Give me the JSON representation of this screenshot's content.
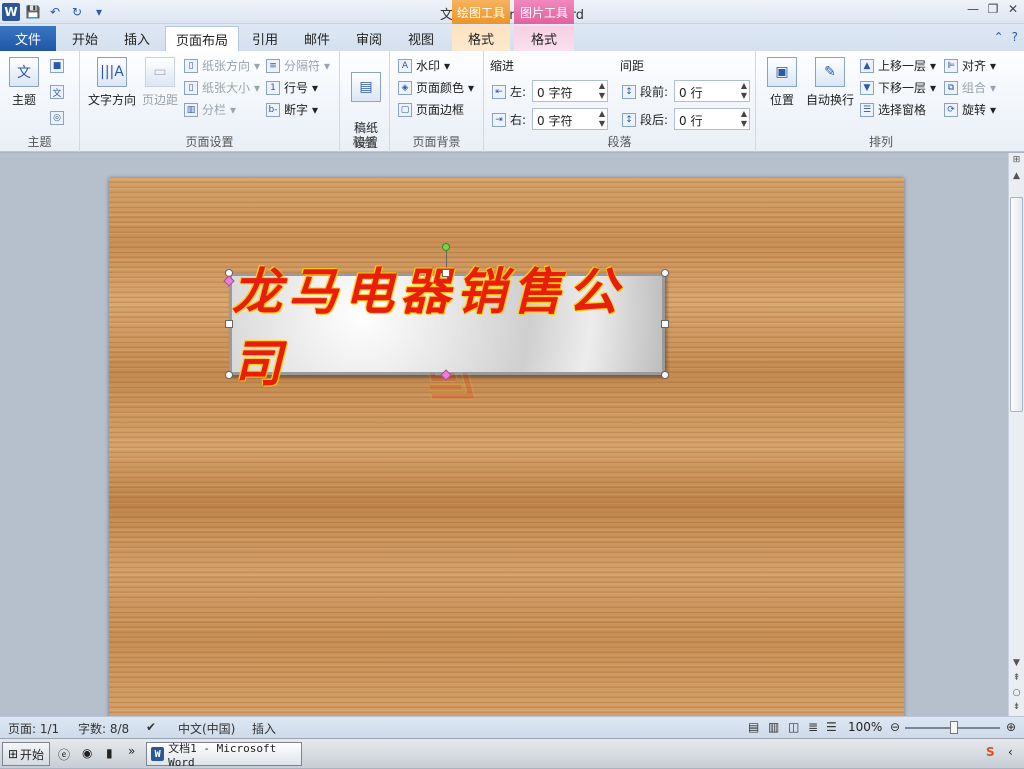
{
  "window": {
    "title": "文档1 - Microsoft Word",
    "context_drawing": "绘图工具",
    "context_picture": "图片工具"
  },
  "tabs": {
    "file": "文件",
    "home": "开始",
    "insert": "插入",
    "layout": "页面布局",
    "references": "引用",
    "mailings": "邮件",
    "review": "审阅",
    "view": "视图",
    "format1": "格式",
    "format2": "格式"
  },
  "ribbon": {
    "themes": {
      "label": "主题",
      "btn": "主题"
    },
    "page_setup": {
      "label": "页面设置",
      "text_direction": "文字方向",
      "margins": "页边距",
      "orientation": "纸张方向",
      "size": "纸张大小",
      "columns": "分栏",
      "breaks": "分隔符",
      "line_numbers": "行号",
      "hyphenation": "断字"
    },
    "draft": {
      "label": "稿纸",
      "btn": "稿纸\n设置"
    },
    "background": {
      "label": "页面背景",
      "watermark": "水印",
      "color": "页面颜色",
      "borders": "页面边框"
    },
    "paragraph": {
      "label": "段落",
      "indent": "缩进",
      "spacing": "间距",
      "left": "左:",
      "right": "右:",
      "before": "段前:",
      "after": "段后:",
      "left_val": "0 字符",
      "right_val": "0 字符",
      "before_val": "0 行",
      "after_val": "0 行"
    },
    "arrange": {
      "label": "排列",
      "position": "位置",
      "wrap": "自动换行",
      "bring_forward": "上移一层",
      "send_backward": "下移一层",
      "selection_pane": "选择窗格",
      "align": "对齐",
      "group": "组合",
      "rotate": "旋转"
    }
  },
  "document": {
    "banner_text": "龙马电器销售公司"
  },
  "status": {
    "page": "页面: 1/1",
    "words": "字数: 8/8",
    "lang": "中文(中国)",
    "mode": "插入",
    "zoom": "100%"
  },
  "taskbar": {
    "start": "开始",
    "task": "文档1 - Microsoft Word"
  }
}
